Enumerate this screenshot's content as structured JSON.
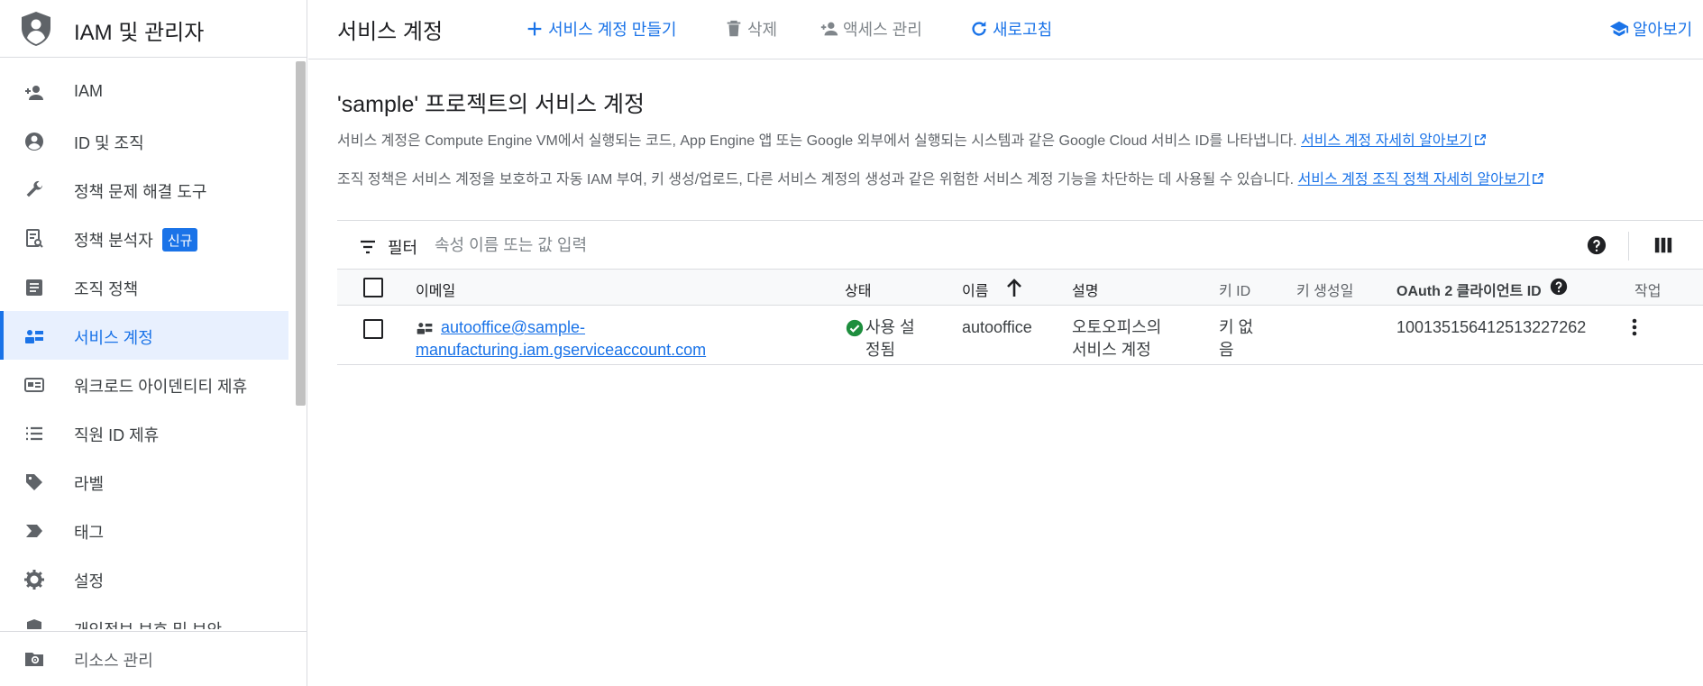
{
  "sidebar": {
    "title": "IAM 및 관리자",
    "items": [
      {
        "label": "IAM",
        "icon": "person-add-icon"
      },
      {
        "label": "ID 및 조직",
        "icon": "account-circle-icon"
      },
      {
        "label": "정책 문제 해결 도구",
        "icon": "wrench-icon"
      },
      {
        "label": "정책 분석자",
        "icon": "policy-analyzer-icon",
        "badge": "신규"
      },
      {
        "label": "조직 정책",
        "icon": "article-icon"
      },
      {
        "label": "서비스 계정",
        "icon": "service-account-icon",
        "active": true
      },
      {
        "label": "워크로드 아이덴티티 제휴",
        "icon": "id-card-icon"
      },
      {
        "label": "직원 ID 제휴",
        "icon": "list-icon"
      },
      {
        "label": "라벨",
        "icon": "label-icon"
      },
      {
        "label": "태그",
        "icon": "tag-chevron-icon"
      },
      {
        "label": "설정",
        "icon": "gear-icon"
      },
      {
        "label": "개인정보 보호 및 보안",
        "icon": "shield-icon"
      }
    ],
    "footer": {
      "label": "리소스 관리",
      "icon": "folder-gear-icon"
    }
  },
  "toolbar": {
    "page_title": "서비스 계정",
    "create_label": "서비스 계정 만들기",
    "delete_label": "삭제",
    "manage_access_label": "액세스 관리",
    "refresh_label": "새로고침",
    "learn_label": "알아보기"
  },
  "main": {
    "section_title": "'sample' 프로젝트의 서비스 계정",
    "desc1": "서비스 계정은 Compute Engine VM에서 실행되는 코드, App Engine 앱 또는 Google 외부에서 실행되는 시스템과 같은 Google Cloud 서비스 ID를 나타냅니다.",
    "desc1_link": "서비스 계정 자세히 알아보기",
    "desc2": "조직 정책은 서비스 계정을 보호하고 자동 IAM 부여, 키 생성/업로드, 다른 서비스 계정의 생성과 같은 위험한 서비스 계정 기능을 차단하는 데 사용될 수 있습니다.",
    "desc2_link": "서비스 계정 조직 정책 자세히 알아보기"
  },
  "filter": {
    "label": "필터",
    "placeholder": "속성 이름 또는 값 입력"
  },
  "table": {
    "headers": {
      "email": "이메일",
      "status": "상태",
      "name": "이름",
      "description": "설명",
      "key_id": "키 ID",
      "key_created": "키 생성일",
      "oauth_client_id": "OAuth 2 클라이언트 ID",
      "actions": "작업"
    },
    "rows": [
      {
        "email_line1": "autooffice@sample-",
        "email_line2": "manufacturing.iam.gserviceaccount.com",
        "status_line1": "사용 설",
        "status_line2": "정됨",
        "name": "autooffice",
        "desc_line1": "오토오피스의",
        "desc_line2": "서비스 계정",
        "key_id_line1": "키 없",
        "key_id_line2": "음",
        "key_created": "",
        "oauth_client_id": "100135156412513227262"
      }
    ]
  },
  "colors": {
    "accent": "#1a73e8",
    "active_bg": "#e8f0fe",
    "status_ok": "#1e8e3e",
    "text_primary": "#202124",
    "text_secondary": "#5f6368",
    "divider": "#dadce0"
  }
}
